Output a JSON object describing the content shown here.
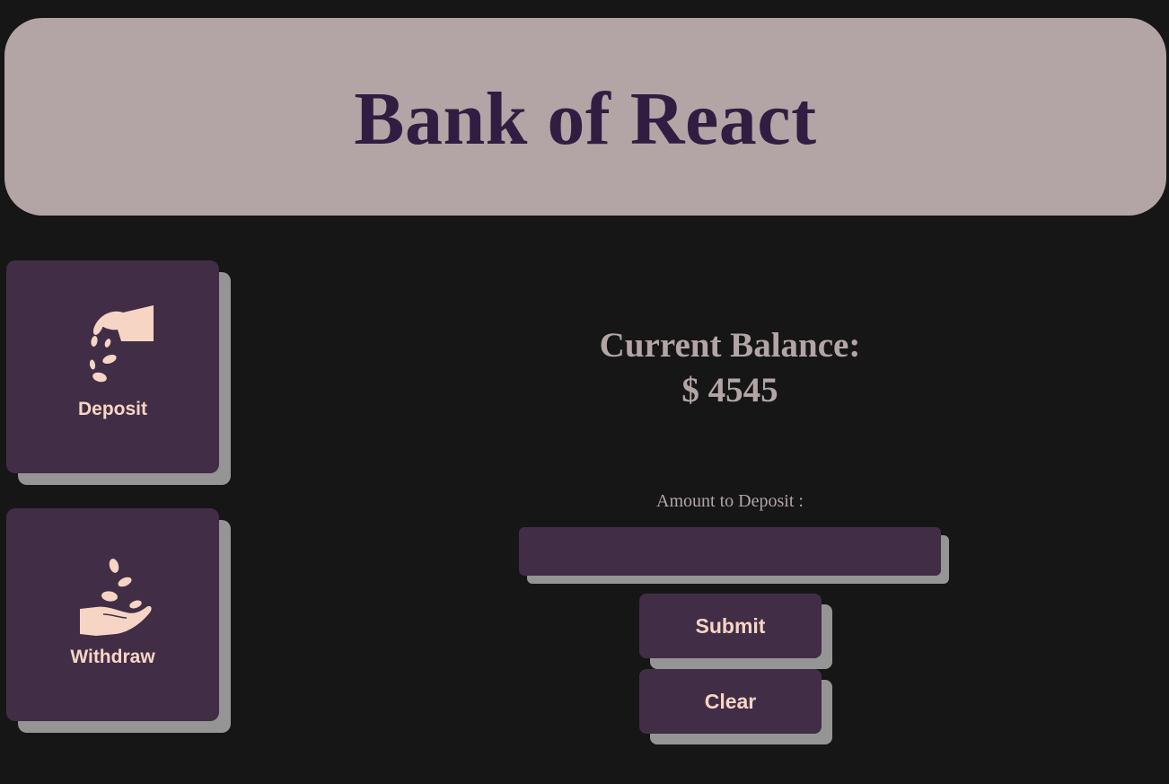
{
  "header": {
    "title": "Bank of React"
  },
  "nav": {
    "deposit": {
      "label": "Deposit",
      "icon": "hand-dropping-coins-icon"
    },
    "withdraw": {
      "label": "Withdraw",
      "icon": "hand-receiving-coins-icon"
    }
  },
  "balance": {
    "label": "Current Balance:",
    "amount": "$ 4545"
  },
  "form": {
    "amount_label": "Amount to Deposit :",
    "amount_value": "",
    "amount_placeholder": "",
    "submit_label": "Submit",
    "clear_label": "Clear"
  },
  "colors": {
    "background": "#161616",
    "header_bg": "#b3a5a6",
    "title": "#321d42",
    "card_bg": "#412e46",
    "shadow": "#959595",
    "accent_text": "#f6d5c4",
    "balance_text": "#b3a5a6"
  }
}
